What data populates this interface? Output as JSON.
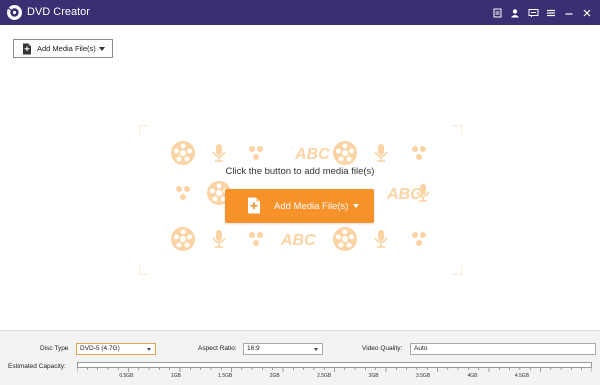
{
  "app": {
    "title": "DVD Creator"
  },
  "titlebar_icons": [
    "file-icon",
    "user-icon",
    "feedback-icon",
    "menu-icon",
    "minimize-icon",
    "close-icon"
  ],
  "toolbar": {
    "add_media_label": "Add Media File(s)"
  },
  "main": {
    "prompt": "Click the button to add media file(s)",
    "add_button_label": "Add Media File(s)",
    "accent_color": "#f7922a"
  },
  "bottom": {
    "disc_type_label": "Disc Type",
    "disc_type_value": "DVD-5 (4.7G)",
    "aspect_ratio_label": "Aspect Ratio:",
    "aspect_ratio_value": "16:9",
    "video_quality_label": "Video Quality:",
    "video_quality_value": "Auto",
    "capacity_label": "Estimated Capacity:",
    "capacity_ticks": [
      "0.5GB",
      "1GB",
      "1.5GB",
      "2GB",
      "2.5GB",
      "3GB",
      "3.5GB",
      "4GB",
      "4.5GB"
    ],
    "capacity_used": 0
  },
  "colors": {
    "titlebar": "#3a2f72",
    "accent": "#f7922a"
  }
}
